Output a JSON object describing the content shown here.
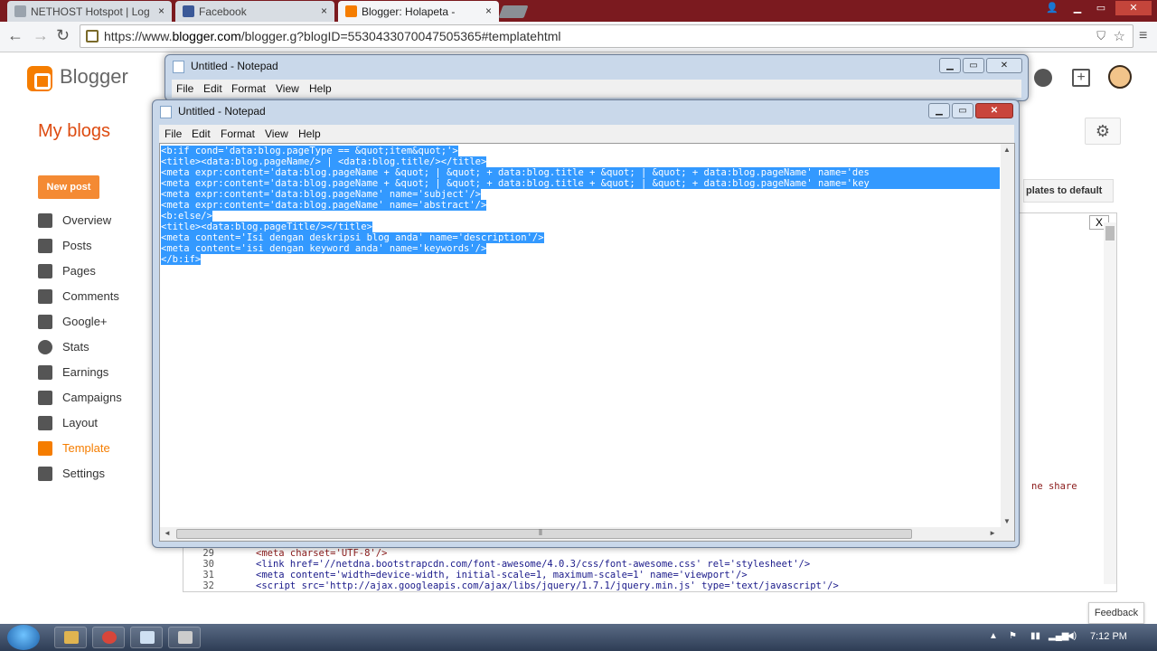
{
  "browser": {
    "tabs": [
      {
        "label": "NETHOST Hotspot | Log",
        "favicon_color": "#9aa3ad"
      },
      {
        "label": "Facebook",
        "favicon_color": "#3b5998"
      },
      {
        "label": "Blogger: Holapeta -",
        "favicon_color": "#f57d00",
        "active": true
      }
    ],
    "tab_close": "×",
    "window_buttons": {
      "minimize": "▁",
      "maximize": "▭",
      "close": "✕"
    },
    "nav": {
      "back": "←",
      "forward": "→",
      "reload": "↻"
    },
    "url_prefix": "https://www.",
    "url_domain": "blogger.com",
    "url_path": "/blogger.g?blogID=5530433070047505365#templatehtml"
  },
  "blogger": {
    "brand": "Blogger",
    "my_blogs": "My blogs",
    "new_post": "New post",
    "nav": [
      {
        "label": "Overview",
        "icon": "home-icon"
      },
      {
        "label": "Posts",
        "icon": "posts-icon"
      },
      {
        "label": "Pages",
        "icon": "pages-icon"
      },
      {
        "label": "Comments",
        "icon": "comments-icon"
      },
      {
        "label": "Google+",
        "icon": "google-plus-icon"
      },
      {
        "label": "Stats",
        "icon": "stats-icon"
      },
      {
        "label": "Earnings",
        "icon": "trophy-icon"
      },
      {
        "label": "Campaigns",
        "icon": "campaigns-icon"
      },
      {
        "label": "Layout",
        "icon": "layout-icon"
      },
      {
        "label": "Template",
        "icon": "template-icon",
        "active": true
      },
      {
        "label": "Settings",
        "icon": "wrench-icon"
      }
    ],
    "gear": "⚙",
    "revert_button": "plates to default",
    "feedback": "Feedback",
    "editor_find_close": "X",
    "share_fragment": "ne share",
    "code_lines": [
      {
        "n": "29",
        "text": "<meta charset='UTF-8'/>"
      },
      {
        "n": "30",
        "text": "<link href='//netdna.bootstrapcdn.com/font-awesome/4.0.3/css/font-awesome.css' rel='stylesheet'/>"
      },
      {
        "n": "31",
        "text": "<meta content='width=device-width, initial-scale=1, maximum-scale=1' name='viewport'/>"
      },
      {
        "n": "32",
        "text": "<script src='http://ajax.googleapis.com/ajax/libs/jquery/1.7.1/jquery.min.js' type='text/javascript'/>"
      }
    ]
  },
  "notepad": {
    "title": "Untitled - Notepad",
    "menu": [
      "File",
      "Edit",
      "Format",
      "View",
      "Help"
    ],
    "selected_lines": [
      "<b:if cond='data:blog.pageType == &quot;item&quot;'>",
      "<title><data:blog.pageName/> | <data:blog.title/></title>",
      "<meta expr:content='data:blog.pageName + &quot; | &quot; + data:blog.title + &quot; | &quot; + data:blog.pageName' name='des",
      "<meta expr:content='data:blog.pageName + &quot; | &quot; + data:blog.title + &quot; | &quot; + data:blog.pageName' name='key",
      "<meta expr:content='data:blog.pageName' name='subject'/>",
      "<meta expr:content='data:blog.pageName' name='abstract'/>",
      "<b:else/>",
      "<title><data:blog.pageTitle/></title>",
      "<meta content='Isi dengan deskripsi blog anda' name='description'/>",
      "<meta content='isi dengan keyword anda' name='keywords'/>",
      "</b:if>"
    ],
    "scroll_grip": "⦀",
    "arrows": {
      "up": "▲",
      "down": "▼",
      "left": "◄",
      "right": "►"
    }
  },
  "taskbar": {
    "clock": "7:12 PM",
    "tray": [
      "▲",
      "⚑",
      "▮▮",
      "◀)"
    ]
  }
}
